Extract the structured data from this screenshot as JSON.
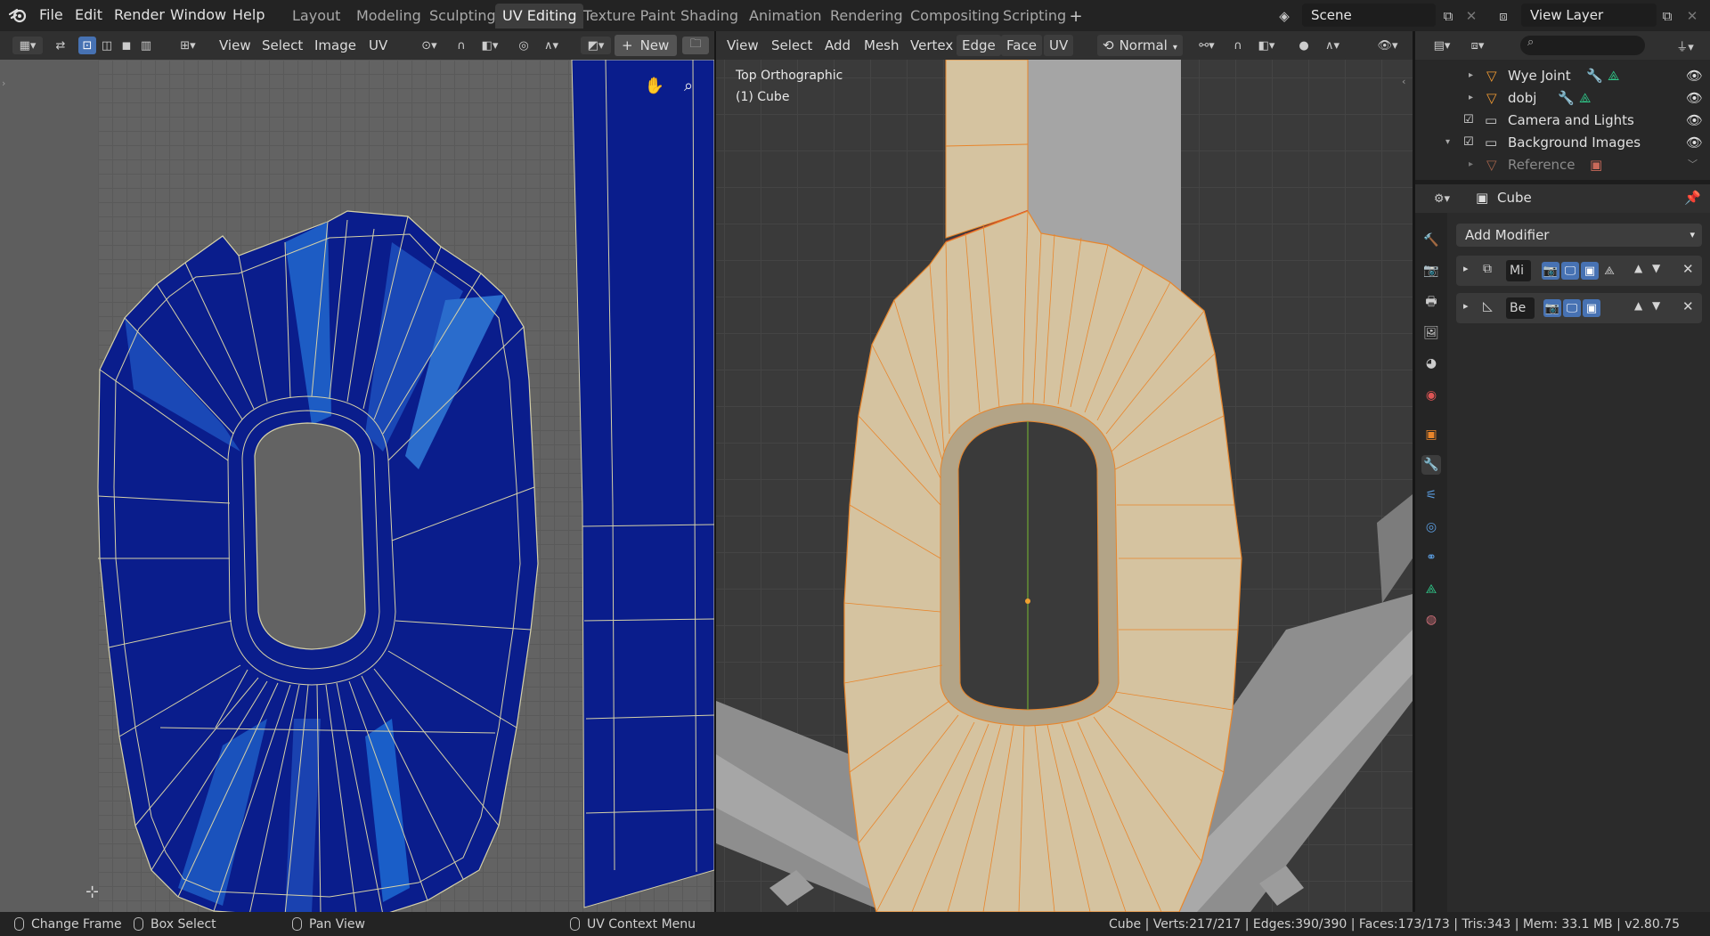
{
  "topbar": {
    "menu": [
      "File",
      "Edit",
      "Render",
      "Window",
      "Help"
    ],
    "workspaces": [
      "Layout",
      "Modeling",
      "Sculpting",
      "UV Editing",
      "Texture Paint",
      "Shading",
      "Animation",
      "Rendering",
      "Compositing",
      "Scripting"
    ],
    "active_workspace": "UV Editing",
    "scene": "Scene",
    "view_layer": "View Layer"
  },
  "uv_header": {
    "menus": [
      "View",
      "Select",
      "Image",
      "UV"
    ],
    "new_label": "New"
  },
  "viewport_header": {
    "menus": [
      "View",
      "Select",
      "Add",
      "Mesh",
      "Vertex",
      "Edge",
      "Face",
      "UV"
    ],
    "orientation": "Normal"
  },
  "viewport": {
    "view_name": "Top Orthographic",
    "object_label": "(1) Cube"
  },
  "outliner": {
    "search_placeholder": "",
    "items": [
      {
        "name": "Wye Joint",
        "type": "mesh"
      },
      {
        "name": "dobj",
        "type": "mesh"
      },
      {
        "name": "Camera and Lights",
        "type": "collection"
      },
      {
        "name": "Background Images",
        "type": "collection"
      },
      {
        "name": "Reference",
        "type": "image"
      }
    ]
  },
  "properties": {
    "object_name": "Cube",
    "add_modifier": "Add Modifier",
    "modifiers": [
      {
        "name": "Mi"
      },
      {
        "name": "Be"
      }
    ]
  },
  "status": {
    "change_frame": "Change Frame",
    "box_select": "Box Select",
    "pan_view": "Pan View",
    "uv_context": "UV Context Menu",
    "stats": "Cube | Verts:217/217 | Edges:390/390 | Faces:173/173 | Tris:343 | Mem: 33.1 MB | v2.80.75"
  },
  "colors": {
    "accent": "#4772b3",
    "uv_face": "#0a1d8c",
    "mesh_face": "#d5c3a0",
    "selection_edge": "#e8852b"
  }
}
